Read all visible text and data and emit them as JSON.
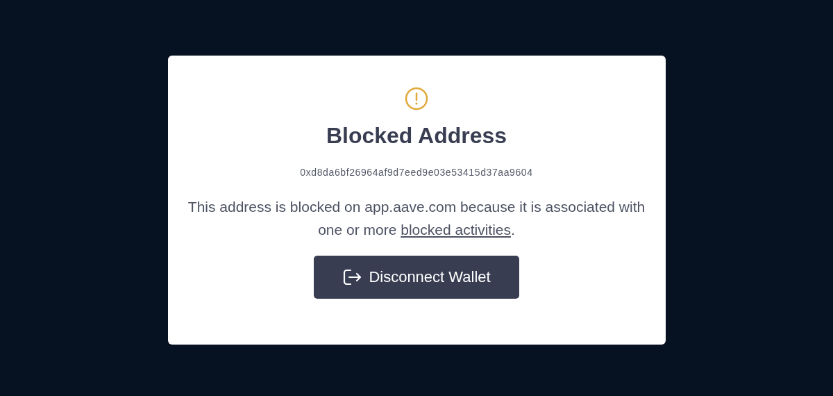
{
  "dialog": {
    "title": "Blocked Address",
    "address": "0xd8da6bf26964af9d7eed9e03e53415d37aa9604",
    "message": {
      "text": "This address is blocked on app.aave.com because it is associated with one or more ",
      "link": "blocked activities",
      "after": "."
    },
    "button": "Disconnect Wallet"
  }
}
